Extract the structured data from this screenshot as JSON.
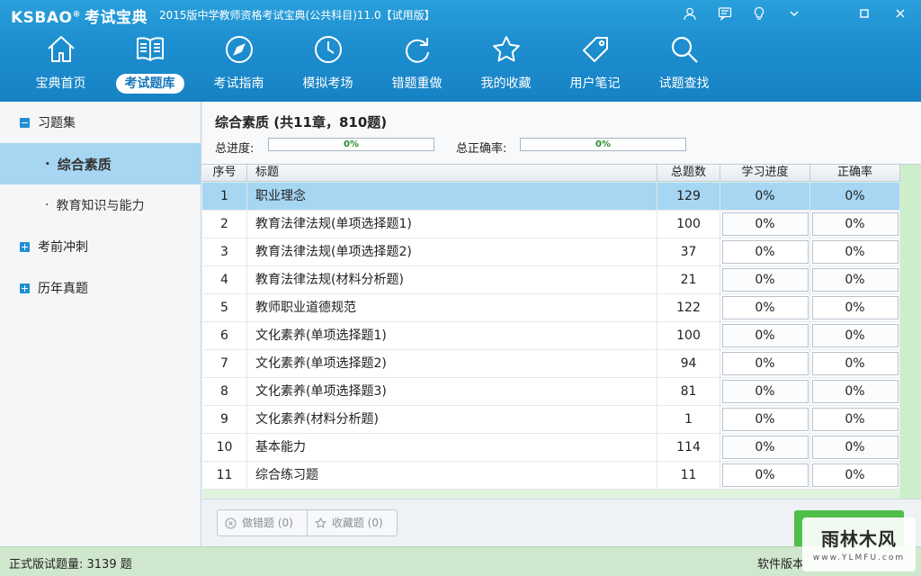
{
  "app": {
    "logo_text": "KSBAO",
    "logo_reg": "®",
    "logo_cn": "考试宝典",
    "window_title": "2015版中学教师资格考试宝典(公共科目)11.0【试用版】"
  },
  "window_controls": [
    "user-icon",
    "message-icon",
    "bulb-icon",
    "dropdown-icon",
    "minimize-icon",
    "close-icon"
  ],
  "nav": {
    "items": [
      {
        "label": "宝典首页",
        "icon": "home-icon"
      },
      {
        "label": "考试题库",
        "icon": "book-icon",
        "active": true
      },
      {
        "label": "考试指南",
        "icon": "compass-icon"
      },
      {
        "label": "模拟考场",
        "icon": "clock-icon"
      },
      {
        "label": "错题重做",
        "icon": "redo-icon"
      },
      {
        "label": "我的收藏",
        "icon": "star-icon"
      },
      {
        "label": "用户笔记",
        "icon": "tag-icon"
      },
      {
        "label": "试题查找",
        "icon": "search-icon"
      }
    ]
  },
  "sidebar": {
    "groups": [
      {
        "label": "习题集",
        "expanded": true,
        "children": [
          {
            "label": "综合素质",
            "active": true
          },
          {
            "label": "教育知识与能力"
          }
        ]
      },
      {
        "label": "考前冲刺",
        "expanded": false
      },
      {
        "label": "历年真题",
        "expanded": false
      }
    ]
  },
  "main": {
    "title": "综合素质 (共11章，810题)",
    "total_progress_label": "总进度:",
    "total_progress_value": "0%",
    "total_accuracy_label": "总正确率:",
    "total_accuracy_value": "0%"
  },
  "table": {
    "headers": {
      "no": "序号",
      "title": "标题",
      "total": "总题数",
      "progress": "学习进度",
      "accuracy": "正确率"
    },
    "rows": [
      {
        "no": "1",
        "title": "职业理念",
        "total": "129",
        "progress": "0%",
        "accuracy": "0%"
      },
      {
        "no": "2",
        "title": "教育法律法规(单项选择题1)",
        "total": "100",
        "progress": "0%",
        "accuracy": "0%"
      },
      {
        "no": "3",
        "title": "教育法律法规(单项选择题2)",
        "total": "37",
        "progress": "0%",
        "accuracy": "0%"
      },
      {
        "no": "4",
        "title": "教育法律法规(材料分析题)",
        "total": "21",
        "progress": "0%",
        "accuracy": "0%"
      },
      {
        "no": "5",
        "title": "教师职业道德规范",
        "total": "122",
        "progress": "0%",
        "accuracy": "0%"
      },
      {
        "no": "6",
        "title": "文化素养(单项选择题1)",
        "total": "100",
        "progress": "0%",
        "accuracy": "0%"
      },
      {
        "no": "7",
        "title": "文化素养(单项选择题2)",
        "total": "94",
        "progress": "0%",
        "accuracy": "0%"
      },
      {
        "no": "8",
        "title": "文化素养(单项选择题3)",
        "total": "81",
        "progress": "0%",
        "accuracy": "0%"
      },
      {
        "no": "9",
        "title": "文化素养(材料分析题)",
        "total": "1",
        "progress": "0%",
        "accuracy": "0%"
      },
      {
        "no": "10",
        "title": "基本能力",
        "total": "114",
        "progress": "0%",
        "accuracy": "0%"
      },
      {
        "no": "11",
        "title": "综合练习题",
        "total": "11",
        "progress": "0%",
        "accuracy": "0%"
      }
    ]
  },
  "bottom": {
    "wrong_button": "做错题 (0)",
    "fav_button": "收藏题 (0)"
  },
  "status": {
    "left": "正式版试题量: 3139 题",
    "right": "软件版本"
  },
  "watermark": {
    "main": "雨林木风",
    "sub": "www.YLMFU.com"
  }
}
